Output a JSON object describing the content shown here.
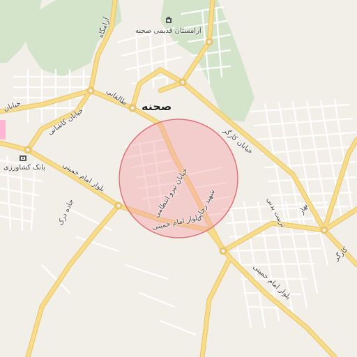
{
  "map": {
    "colors": {
      "background": "#f2efe9",
      "park": "#d4e4ca",
      "major_road": "#f7dc8a",
      "major_road_casing": "#e9c46a",
      "minor_road": "#ffffff",
      "minor_road_casing": "#d9d4cc",
      "radius_fill": "#f4a4a8",
      "radius_stroke": "#e0737a",
      "accent": "#ffb6d0"
    },
    "city_label": "صحنه",
    "pois": {
      "ancient_cemetery": "آرامستان قدیمی صحنه",
      "bank": "بانک کشاورزی"
    },
    "streets": {
      "taleghani": "طالقانی",
      "kashani": "خیابان کاشانی",
      "arameh": "آرامگاه",
      "khiaban_left": "خیابان",
      "imam_khomeini_blvd_1": "بلوار امام خمینی",
      "imam_khomeini_blvd_2": "بلوار امام خمینی",
      "imam_khomeini_blvd_3": "بلوار امام خمینی",
      "entezami": "خیابان نیرو انتظامی",
      "shahid_rajai": "شهید رجایی",
      "karegar_1": "خیابان کارگر",
      "karegar_2": "کارگر",
      "tarbiat_badani": "تربیت بدنی",
      "jadeh": "جاده درک",
      "bahar": "بهار"
    },
    "search_radius": {
      "shown": true
    }
  }
}
